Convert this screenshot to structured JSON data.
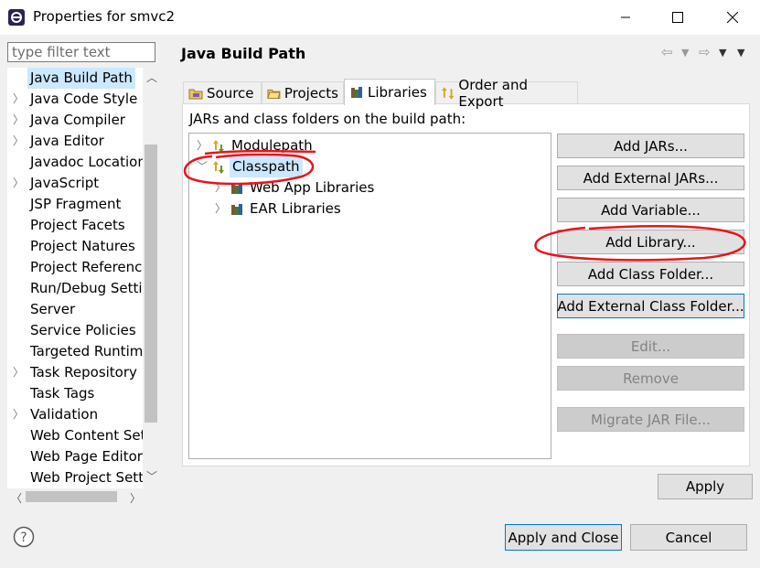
{
  "window": {
    "title": "Properties for smvc2",
    "app_icon": "eclipse-icon",
    "controls": [
      "minimize-icon",
      "maximize-icon",
      "close-icon"
    ]
  },
  "filter": {
    "placeholder": "type filter text",
    "value": ""
  },
  "nav_tree": {
    "items": [
      {
        "label": "Java Build Path",
        "expandable": false,
        "selected": true
      },
      {
        "label": "Java Code Style",
        "expandable": true
      },
      {
        "label": "Java Compiler",
        "expandable": true
      },
      {
        "label": "Java Editor",
        "expandable": true
      },
      {
        "label": "Javadoc Location",
        "expandable": false
      },
      {
        "label": "JavaScript",
        "expandable": true
      },
      {
        "label": "JSP Fragment",
        "expandable": false
      },
      {
        "label": "Project Facets",
        "expandable": false
      },
      {
        "label": "Project Natures",
        "expandable": false
      },
      {
        "label": "Project References",
        "expandable": false
      },
      {
        "label": "Run/Debug Settings",
        "expandable": false
      },
      {
        "label": "Server",
        "expandable": false
      },
      {
        "label": "Service Policies",
        "expandable": false
      },
      {
        "label": "Targeted Runtimes",
        "expandable": false
      },
      {
        "label": "Task Repository",
        "expandable": true
      },
      {
        "label": "Task Tags",
        "expandable": false
      },
      {
        "label": "Validation",
        "expandable": true
      },
      {
        "label": "Web Content Settings",
        "expandable": false
      },
      {
        "label": "Web Page Editor",
        "expandable": false
      },
      {
        "label": "Web Project Settings",
        "expandable": false
      }
    ]
  },
  "page": {
    "title": "Java Build Path",
    "tabs": [
      {
        "label": "Source",
        "icon": "source-folder-icon",
        "active": false
      },
      {
        "label": "Projects",
        "icon": "projects-icon",
        "active": false
      },
      {
        "label": "Libraries",
        "icon": "libraries-icon",
        "active": true
      },
      {
        "label": "Order and Export",
        "icon": "order-export-icon",
        "active": false
      }
    ],
    "heading": "JARs and class folders on the build path:",
    "entries": [
      {
        "label": "Modulepath",
        "icon": "modulepath-icon",
        "expanded": false,
        "level": 0
      },
      {
        "label": "Classpath",
        "icon": "classpath-icon",
        "expanded": true,
        "level": 0,
        "selected": true
      },
      {
        "label": "Web App Libraries",
        "icon": "library-icon",
        "expanded": false,
        "level": 1
      },
      {
        "label": "EAR Libraries",
        "icon": "library-icon",
        "expanded": false,
        "level": 1
      }
    ],
    "buttons": [
      {
        "label": "Add JARs...",
        "enabled": true
      },
      {
        "label": "Add External JARs...",
        "enabled": true
      },
      {
        "label": "Add Variable...",
        "enabled": true
      },
      {
        "label": "Add Library...",
        "enabled": true
      },
      {
        "label": "Add Class Folder...",
        "enabled": true
      },
      {
        "label": "Add External Class Folder...",
        "enabled": true,
        "focused": true
      },
      {
        "label": "Edit...",
        "enabled": false
      },
      {
        "label": "Remove",
        "enabled": false
      },
      {
        "label": "Migrate JAR File...",
        "enabled": false
      }
    ],
    "apply_label": "Apply"
  },
  "footer": {
    "help_icon": "help-icon",
    "apply_close_label": "Apply and Close",
    "cancel_label": "Cancel"
  },
  "colors": {
    "selection": "#cce8ff",
    "focus_border": "#0078d7",
    "annotation": "#e8151b"
  }
}
